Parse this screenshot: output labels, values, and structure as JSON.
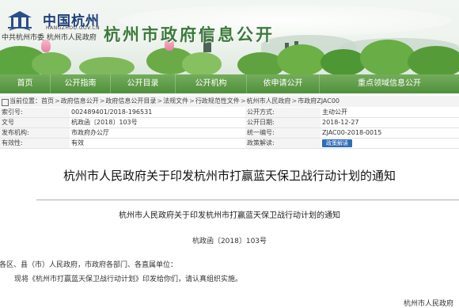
{
  "header": {
    "logo_cn": "中国杭州",
    "logo_en": "HANGZHOU.GOV.CN",
    "logo_sub": "中共杭州市委  杭州市人民政府",
    "site_title": "杭州市政府信息公开"
  },
  "nav": {
    "items": [
      "首页",
      "公开指南",
      "公开目录",
      "公开机构",
      "依申请公开",
      "重点领域信息公开"
    ]
  },
  "breadcrumb": {
    "label": "当前位置：",
    "items": [
      "首页",
      "政府信息公开",
      "政府信息公开目录",
      "法规文件",
      "行政规范性文件",
      "杭州市人民政府",
      "市政府ZJAC00"
    ]
  },
  "info": {
    "rows": [
      {
        "k1": "索引号:",
        "v1": "002489401/2018-196531",
        "k2": "公开方式:",
        "v2": "主动公开"
      },
      {
        "k1": "文号",
        "v1": "杭政函〔2018〕103号",
        "k2": "公开日期:",
        "v2": "2018-12-27"
      },
      {
        "k1": "发布机构:",
        "v1": "市政府办公厅",
        "k2": "统一编号:",
        "v2": "ZJAC00-2018-0015"
      },
      {
        "k1": "有效性:",
        "v1": "有效",
        "k2": "政策解读:",
        "v2": ""
      }
    ],
    "interp_button": "政策解读"
  },
  "doc": {
    "title": "杭州市人民政府关于印发杭州市打赢蓝天保卫战行动计划的通知",
    "subtitle": "杭州市人民政府关于印发杭州市打赢蓝天保卫战行动计划的通知",
    "number": "杭政函〔2018〕103号",
    "addressee": "各区、县（市）人民政府，市政府各部门、各直属单位：",
    "body": "现将《杭州市打赢蓝天保卫战行动计划》印发给你们，请认真组织实施。",
    "signature": "杭州市人民政府"
  }
}
